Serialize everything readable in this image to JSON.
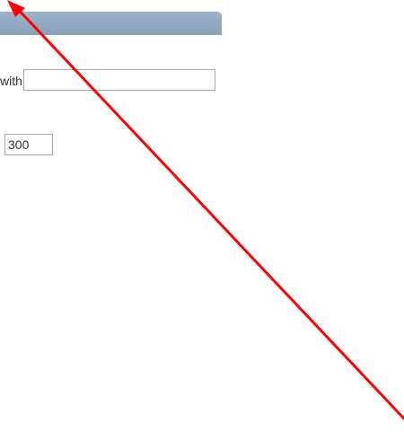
{
  "form": {
    "header_label": "",
    "starts_with_label": "with",
    "starts_with_value": "",
    "number_value": "300"
  },
  "annotation": {
    "type": "arrow",
    "color": "#ff0000"
  }
}
